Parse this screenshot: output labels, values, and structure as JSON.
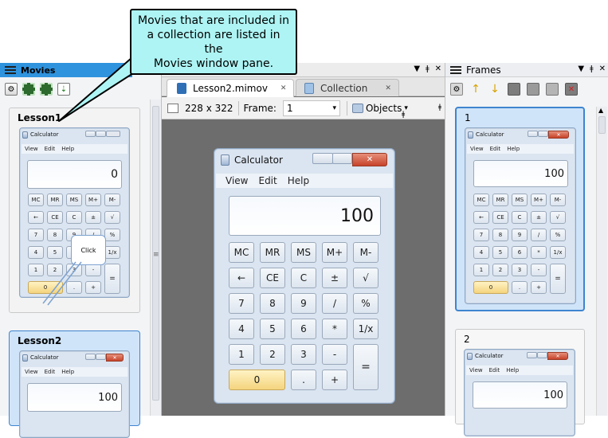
{
  "callout": {
    "text": "Movies that are included in\na collection are listed in the\nMovies window pane."
  },
  "movies_pane": {
    "title": "Movies",
    "title_controls": [
      "▼"
    ],
    "toolbar_icons": [
      "movie-settings-icon",
      "film-add-icon",
      "film-icon",
      "film-export-icon"
    ],
    "lessons": [
      {
        "label": "Lesson1",
        "calc_title": "Calculator",
        "menu": [
          "View",
          "Edit",
          "Help"
        ],
        "display": "0"
      },
      {
        "label": "Lesson2",
        "calc_title": "Calculator",
        "menu": [
          "View",
          "Edit",
          "Help"
        ],
        "display": "100"
      }
    ],
    "click_bubble": "Click"
  },
  "editor": {
    "controls": [
      "▼",
      "ǂ",
      "✕"
    ],
    "tabs": [
      {
        "label": "Lesson2.mimov",
        "close": "✕"
      },
      {
        "label": "Collection",
        "close": "✕"
      }
    ],
    "toolbar": {
      "size": "228 x 322",
      "frame_label": "Frame:",
      "frame_value": "1",
      "objects_label": "Objects",
      "dropdown_glyph": "▾"
    },
    "calculator": {
      "title": "Calculator",
      "menu": [
        "View",
        "Edit",
        "Help"
      ],
      "display": "100",
      "keys": [
        [
          "MC",
          "MR",
          "MS",
          "M+",
          "M-"
        ],
        [
          "←",
          "CE",
          "C",
          "±",
          "√"
        ],
        [
          "7",
          "8",
          "9",
          "/",
          "%"
        ],
        [
          "4",
          "5",
          "6",
          "*",
          "1/x"
        ],
        [
          "1",
          "2",
          "3",
          "-",
          "="
        ],
        [
          "0",
          ".",
          "+"
        ]
      ]
    }
  },
  "frames_pane": {
    "title": "Frames",
    "controls": [
      "▼",
      "ǂ",
      "✕"
    ],
    "toolbar_icons": [
      "gear-icon",
      "arrow-up-icon",
      "arrow-down-icon",
      "frame-add-icon",
      "frame-duplicate-icon",
      "frame-insert-icon",
      "frame-delete-icon"
    ],
    "frames": [
      {
        "label": "1",
        "calc_title": "Calculator",
        "menu": [
          "View",
          "Edit",
          "Help"
        ],
        "display": "100"
      },
      {
        "label": "2",
        "calc_title": "Calculator",
        "menu": [
          "View",
          "Edit",
          "Help"
        ],
        "display": "100"
      }
    ]
  },
  "colors": {
    "accent": "#3e84cf",
    "movies_header": "#2f93de",
    "callout_fill": "#aef4f4",
    "canvas": "#6d6d6d"
  }
}
